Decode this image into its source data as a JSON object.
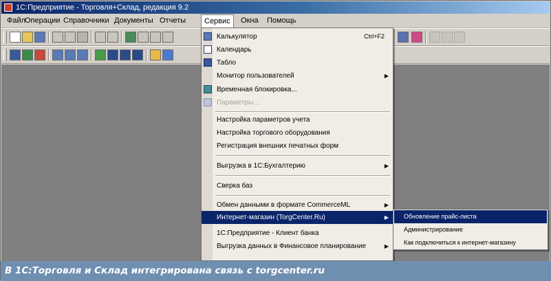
{
  "window": {
    "title": "1С:Предприятие - Торговля+Склад, редакция 9.2"
  },
  "menubar": {
    "items": [
      {
        "label": "Файл"
      },
      {
        "label": "Операции"
      },
      {
        "label": "Справочники"
      },
      {
        "label": "Документы"
      },
      {
        "label": "Отчеты"
      },
      {
        "label": "Сервис"
      },
      {
        "label": "Окна"
      },
      {
        "label": "Помощь"
      }
    ],
    "open_item_index": 5
  },
  "service_menu": {
    "items": [
      {
        "label": "Калькулятор",
        "shortcut": "Ctrl+F2",
        "icon": "calculator-icon"
      },
      {
        "label": "Календарь",
        "icon": "calendar-icon"
      },
      {
        "label": "Табло",
        "icon": "table-icon"
      },
      {
        "label": "Монитор пользователей",
        "submenu": true
      },
      {
        "label": "Временная блокировка...",
        "icon": "lock-icon"
      },
      {
        "label": "Параметры...",
        "disabled": true,
        "icon": "filter-icon"
      },
      {
        "label": "Настройка параметров учета"
      },
      {
        "label": "Настройка торгового оборудования"
      },
      {
        "label": "Регистрация внешних печатных форм"
      },
      {
        "label": "Выгрузка в 1С:Бухгалтерию",
        "submenu": true
      },
      {
        "label": "Сверка баз"
      },
      {
        "label": "Обмен данными в формате CommerceML",
        "submenu": true
      },
      {
        "label": "Интернет-магазин (TorgCenter.Ru)",
        "submenu": true,
        "highlighted": true
      },
      {
        "label": "1С:Предприятие - Клиент банка"
      },
      {
        "label": "Выгрузка данных в Финансовое планирование",
        "submenu": true
      }
    ]
  },
  "internet_shop_submenu": {
    "items": [
      {
        "label": "Обновление прайс-листа",
        "highlighted": true
      },
      {
        "label": "Администрирование"
      },
      {
        "label": "Как подключиться к интернет-магазину"
      }
    ]
  },
  "caption": {
    "text": "В 1С:Торговля и Склад интегрирована связь с torgcenter.ru"
  },
  "colors": {
    "highlight": "#0a246a",
    "caption_bg": "#6f8fb0",
    "workspace": "#808080"
  }
}
